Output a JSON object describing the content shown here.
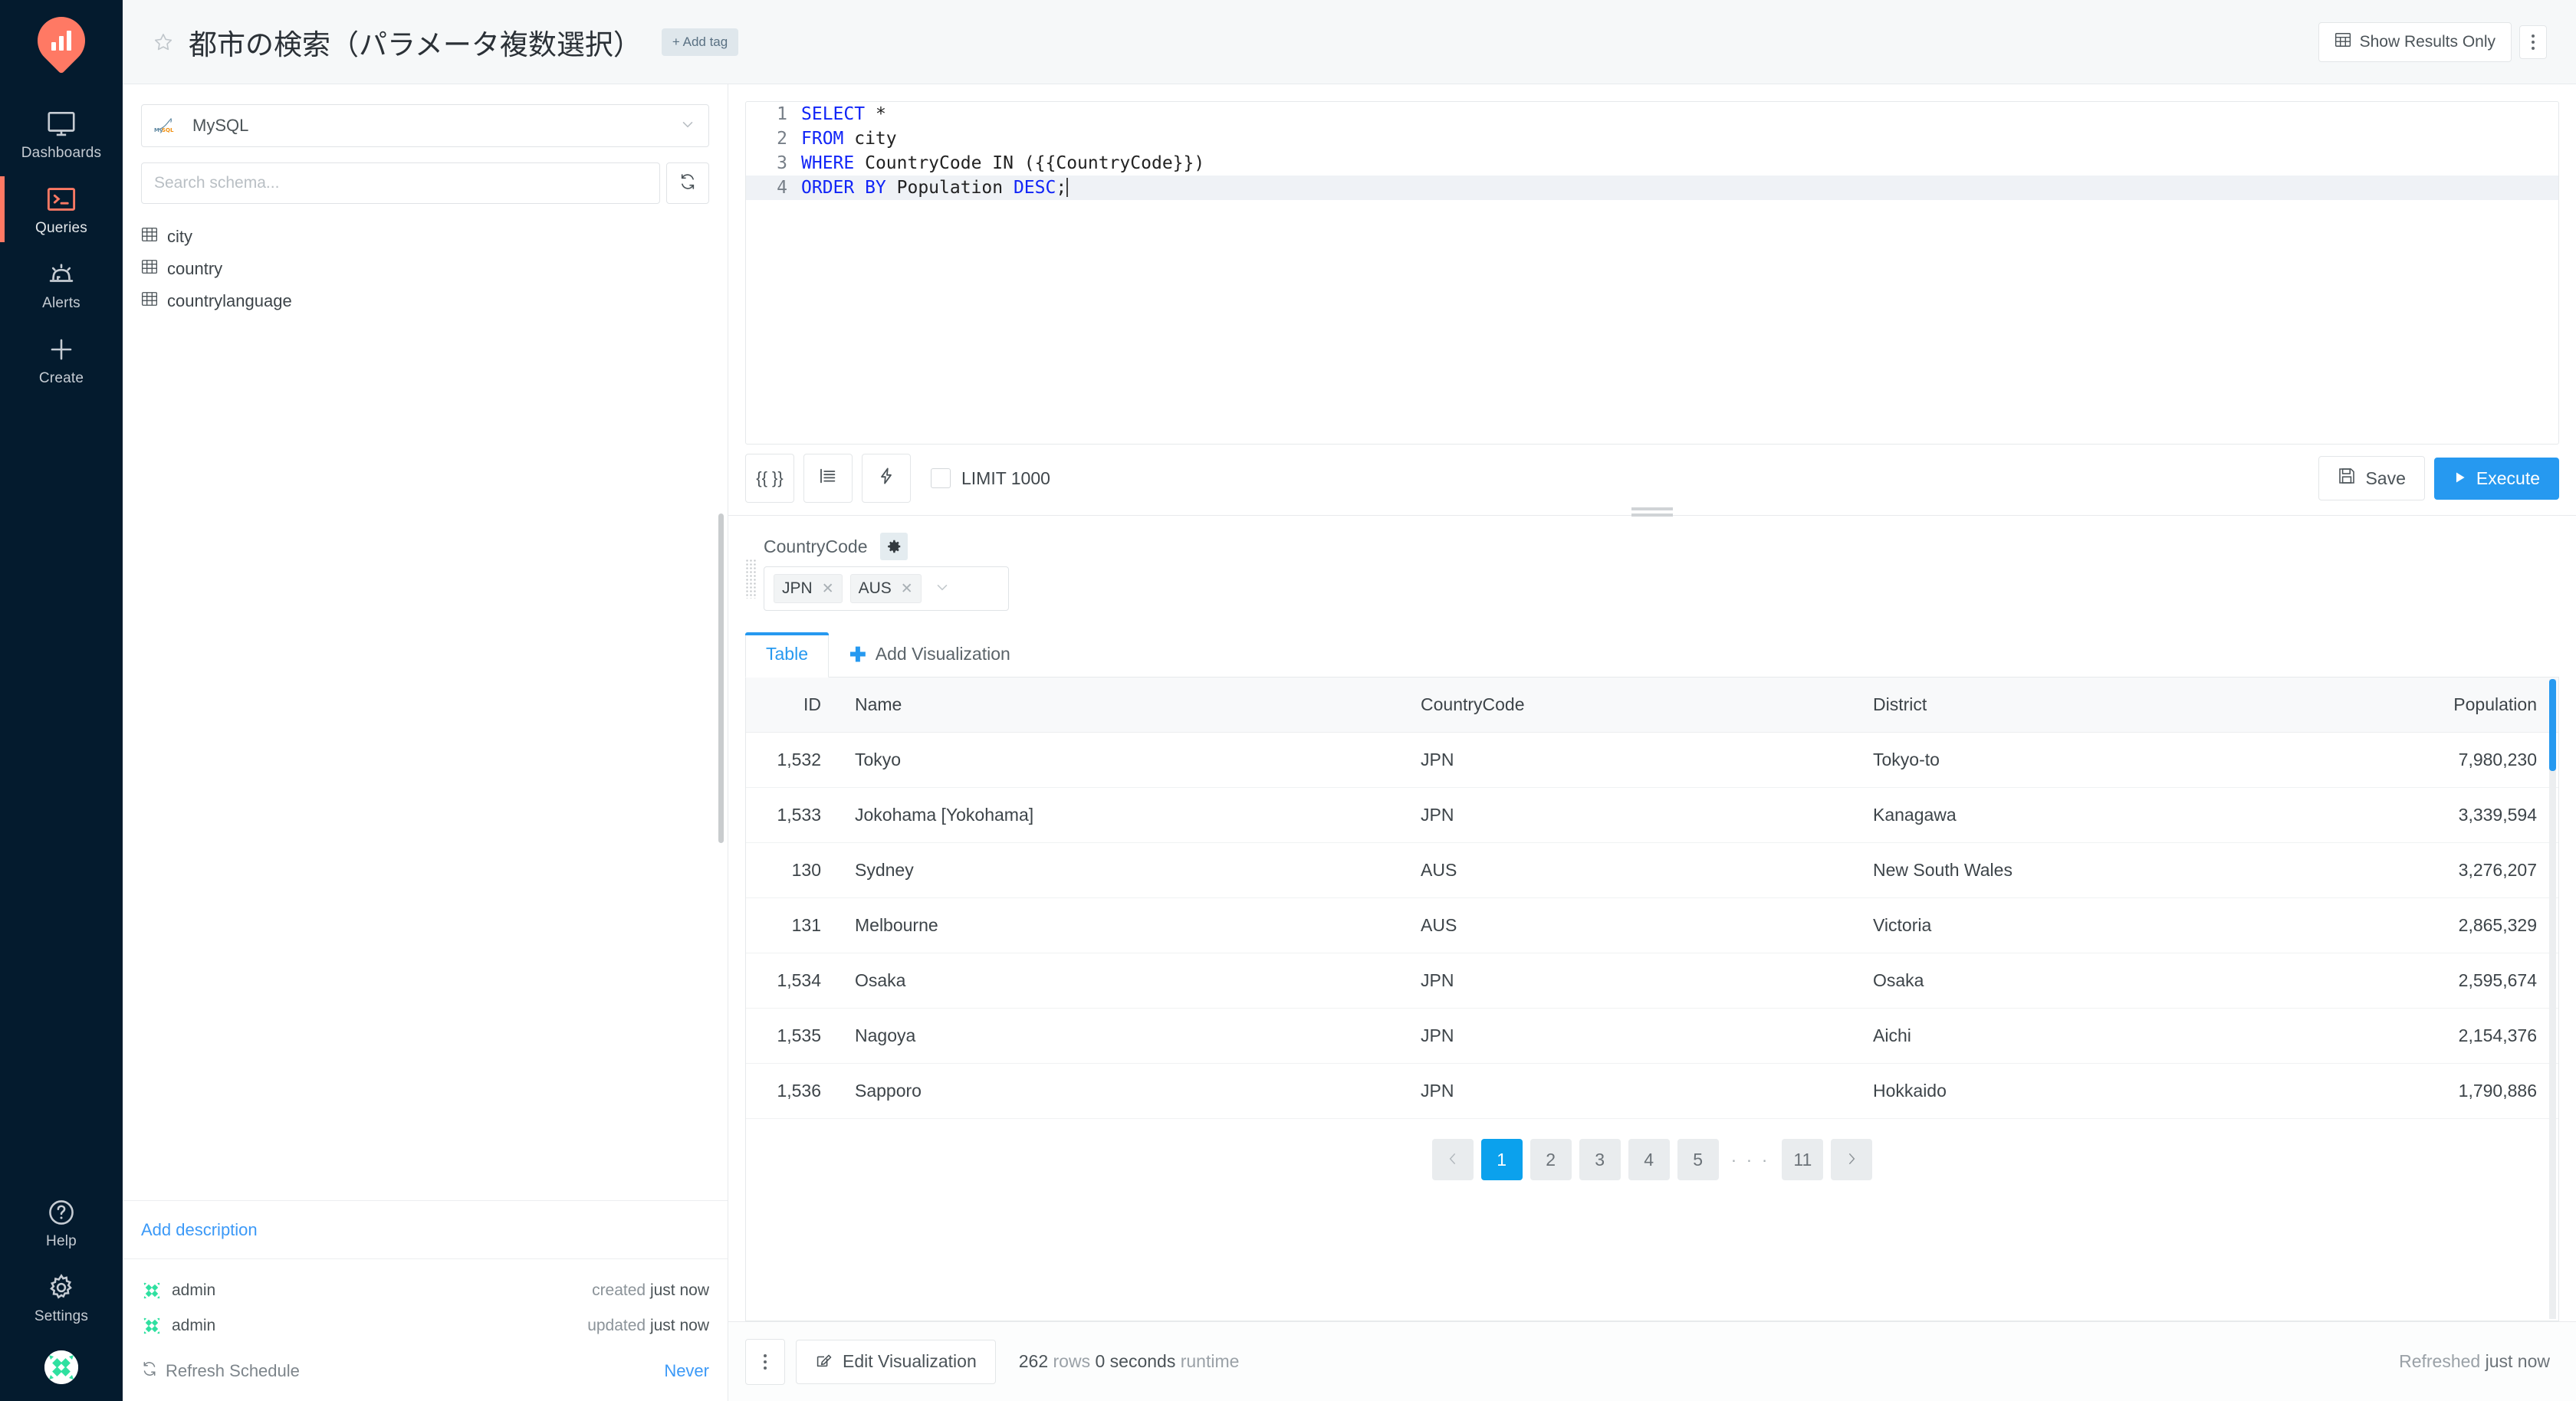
{
  "sidebar": {
    "logo": "redash-logo",
    "items": [
      {
        "label": "Dashboards",
        "icon": "monitor-icon",
        "active": false
      },
      {
        "label": "Queries",
        "icon": "terminal-icon",
        "active": true
      },
      {
        "label": "Alerts",
        "icon": "bell-icon",
        "active": false
      },
      {
        "label": "Create",
        "icon": "plus-icon",
        "active": false
      }
    ],
    "bottom_items": [
      {
        "label": "Help",
        "icon": "question-circle-icon"
      },
      {
        "label": "Settings",
        "icon": "gear-icon"
      }
    ],
    "avatar": "user-avatar"
  },
  "topbar": {
    "star_icon": "star-outline-icon",
    "title": "都市の検索（パラメータ複数選択）",
    "add_tag_label": "+ Add tag",
    "show_results_only_label": "Show Results Only",
    "show_results_only_icon": "table-icon",
    "more_menu_icon": "kebab-menu-icon"
  },
  "schema_panel": {
    "datasource": {
      "name": "MySQL",
      "icon": "mysql-icon",
      "chevron": "chevron-down-icon"
    },
    "search": {
      "placeholder": "Search schema...",
      "value": ""
    },
    "refresh_icon": "refresh-icon",
    "tables": [
      {
        "name": "city",
        "icon": "table-icon"
      },
      {
        "name": "country",
        "icon": "table-icon"
      },
      {
        "name": "countrylanguage",
        "icon": "table-icon"
      }
    ],
    "add_description_label": "Add description",
    "meta": [
      {
        "user": "admin",
        "action": "created",
        "time": "just now"
      },
      {
        "user": "admin",
        "action": "updated",
        "time": "just now"
      }
    ],
    "refresh_schedule": {
      "icon": "refresh-icon",
      "label": "Refresh Schedule",
      "value": "Never"
    }
  },
  "editor": {
    "lines": [
      {
        "n": "1",
        "html": "<span class='kw'>SELECT</span> *"
      },
      {
        "n": "2",
        "html": "<span class='kw'>FROM</span> city"
      },
      {
        "n": "3",
        "html": "<span class='kw'>WHERE</span> CountryCode IN ({{CountryCode}})"
      },
      {
        "n": "4",
        "html": "<span class='kw'>ORDER BY</span> Population <span class='kw'>DESC</span>;",
        "active": true
      }
    ],
    "raw_query": "SELECT *\nFROM city\nWHERE CountryCode IN ({{CountryCode}})\nORDER BY Population DESC;"
  },
  "toolbar": {
    "format_param_label": "{{ }}",
    "indent_icon": "indent-icon",
    "autocomplete_icon": "lightning-icon",
    "limit_label": "LIMIT 1000",
    "limit_checked": false,
    "save_label": "Save",
    "save_icon": "save-icon",
    "execute_label": "Execute",
    "execute_icon": "play-icon",
    "execute_color": "#2699f0"
  },
  "parameters": [
    {
      "name": "CountryCode",
      "settings_icon": "gear-icon",
      "values": [
        "JPN",
        "AUS"
      ],
      "remove_icon": "close-icon",
      "chevron": "chevron-down-icon"
    }
  ],
  "viz_tabs": {
    "tabs": [
      {
        "label": "Table",
        "active": true
      }
    ],
    "add_label": "Add Visualization",
    "add_icon": "plus-icon"
  },
  "results_table": {
    "columns": [
      "ID",
      "Name",
      "CountryCode",
      "District",
      "Population"
    ],
    "rows": [
      [
        "1,532",
        "Tokyo",
        "JPN",
        "Tokyo-to",
        "7,980,230"
      ],
      [
        "1,533",
        "Jokohama [Yokohama]",
        "JPN",
        "Kanagawa",
        "3,339,594"
      ],
      [
        "130",
        "Sydney",
        "AUS",
        "New South Wales",
        "3,276,207"
      ],
      [
        "131",
        "Melbourne",
        "AUS",
        "Victoria",
        "2,865,329"
      ],
      [
        "1,534",
        "Osaka",
        "JPN",
        "Osaka",
        "2,595,674"
      ],
      [
        "1,535",
        "Nagoya",
        "JPN",
        "Aichi",
        "2,154,376"
      ],
      [
        "1,536",
        "Sapporo",
        "JPN",
        "Hokkaido",
        "1,790,886"
      ]
    ]
  },
  "pagination": {
    "prev_icon": "chevron-left-icon",
    "next_icon": "chevron-right-icon",
    "pages": [
      "1",
      "2",
      "3",
      "4",
      "5"
    ],
    "ellipsis": "· · ·",
    "last_page": "11",
    "current": "1"
  },
  "statusbar": {
    "more_icon": "kebab-menu-icon",
    "edit_viz_label": "Edit Visualization",
    "edit_viz_icon": "pencil-square-icon",
    "rows_count": "262",
    "rows_label": "rows",
    "runtime_value": "0 seconds",
    "runtime_label": "runtime",
    "refreshed_label": "Refreshed",
    "refreshed_value": "just now"
  }
}
